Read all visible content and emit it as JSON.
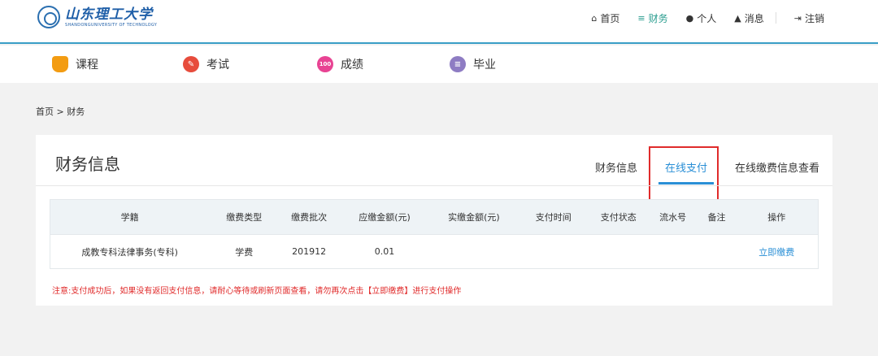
{
  "header": {
    "logo_text": "山东理工大学",
    "logo_en": "SHANDONGUNIVERSITY OF TECHNOLOGY",
    "nav": [
      {
        "label": "首页",
        "icon": "home-icon"
      },
      {
        "label": "财务",
        "icon": "database-icon",
        "active": true
      },
      {
        "label": "个人",
        "icon": "user-icon"
      },
      {
        "label": "消息",
        "icon": "bell-icon"
      },
      {
        "label": "注销",
        "icon": "logout-icon"
      }
    ]
  },
  "modules": [
    {
      "label": "课程",
      "icon": "course-icon"
    },
    {
      "label": "考试",
      "icon": "exam-icon"
    },
    {
      "label": "成绩",
      "icon": "score-icon",
      "badge": "100"
    },
    {
      "label": "毕业",
      "icon": "graduation-icon"
    }
  ],
  "breadcrumb": "首页 > 财务",
  "card": {
    "title": "财务信息",
    "tabs": [
      {
        "label": "财务信息"
      },
      {
        "label": "在线支付",
        "active": true
      },
      {
        "label": "在线缴费信息查看"
      }
    ]
  },
  "table": {
    "headers": [
      "学籍",
      "缴费类型",
      "缴费批次",
      "应缴金额(元)",
      "实缴金额(元)",
      "支付时间",
      "支付状态",
      "流水号",
      "备注",
      "操作"
    ],
    "rows": [
      {
        "xueji": "成教专科法律事务(专科)",
        "type": "学费",
        "batch": "201912",
        "due": "0.01",
        "paid": "",
        "time": "",
        "status": "",
        "serial": "",
        "remark": "",
        "action": "立即缴费"
      }
    ]
  },
  "notice": "注意:支付成功后，如果没有返回支付信息，请耐心等待或刷新页面查看，请勿再次点击【立即缴费】进行支付操作",
  "colors": {
    "accent": "#2a8fd6",
    "active_nav": "#2a9d8f",
    "highlight": "#e02b2b"
  }
}
